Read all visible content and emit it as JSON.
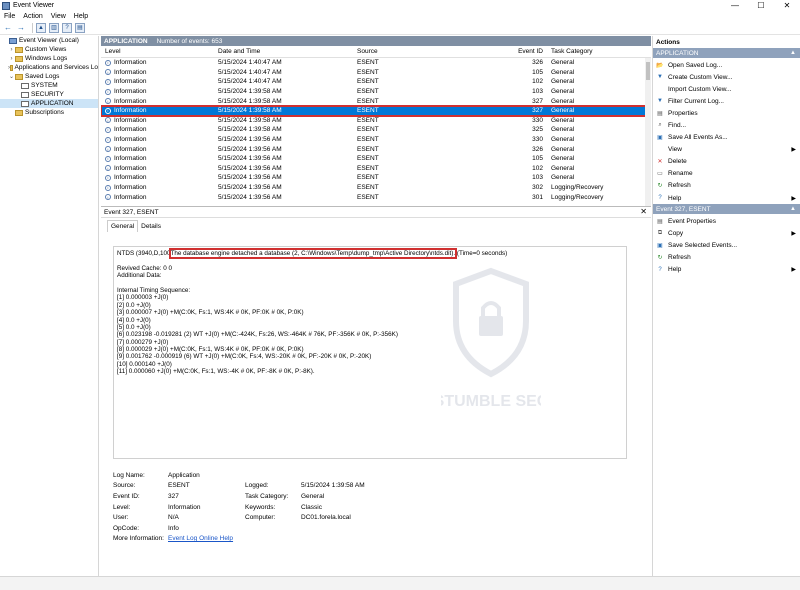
{
  "window": {
    "title": "Event Viewer",
    "min": "—",
    "max": "☐",
    "close": "✕"
  },
  "menu": [
    "File",
    "Action",
    "View",
    "Help"
  ],
  "tree": [
    {
      "label": "Event Viewer (Local)",
      "exp": "",
      "icon": "root",
      "indent": 0
    },
    {
      "label": "Custom Views",
      "exp": "›",
      "icon": "folder",
      "indent": 1
    },
    {
      "label": "Windows Logs",
      "exp": "›",
      "icon": "folder",
      "indent": 1
    },
    {
      "label": "Applications and Services Lo",
      "exp": "›",
      "icon": "folder",
      "indent": 1
    },
    {
      "label": "Saved Logs",
      "exp": "⌄",
      "icon": "folder",
      "indent": 1
    },
    {
      "label": "SYSTEM",
      "exp": "",
      "icon": "log",
      "indent": 2
    },
    {
      "label": "SECURITY",
      "exp": "",
      "icon": "log",
      "indent": 2
    },
    {
      "label": "APPLICATION",
      "exp": "",
      "icon": "log",
      "indent": 2,
      "selected": true
    },
    {
      "label": "Subscriptions",
      "exp": "",
      "icon": "folder",
      "indent": 1
    }
  ],
  "log": {
    "name": "APPLICATION",
    "count": "Number of events: 653"
  },
  "columns": {
    "level": "Level",
    "date": "Date and Time",
    "source": "Source",
    "id": "Event ID",
    "cat": "Task Category"
  },
  "rows": [
    {
      "level": "Information",
      "date": "5/15/2024 1:40:47 AM",
      "source": "ESENT",
      "id": "326",
      "cat": "General"
    },
    {
      "level": "Information",
      "date": "5/15/2024 1:40:47 AM",
      "source": "ESENT",
      "id": "105",
      "cat": "General"
    },
    {
      "level": "Information",
      "date": "5/15/2024 1:40:47 AM",
      "source": "ESENT",
      "id": "102",
      "cat": "General"
    },
    {
      "level": "Information",
      "date": "5/15/2024 1:39:58 AM",
      "source": "ESENT",
      "id": "103",
      "cat": "General"
    },
    {
      "level": "Information",
      "date": "5/15/2024 1:39:58 AM",
      "source": "ESENT",
      "id": "327",
      "cat": "General"
    },
    {
      "level": "Information",
      "date": "5/15/2024 1:39:58 AM",
      "source": "ESENT",
      "id": "327",
      "cat": "General",
      "selected": true
    },
    {
      "level": "Information",
      "date": "5/15/2024 1:39:58 AM",
      "source": "ESENT",
      "id": "330",
      "cat": "General"
    },
    {
      "level": "Information",
      "date": "5/15/2024 1:39:58 AM",
      "source": "ESENT",
      "id": "325",
      "cat": "General"
    },
    {
      "level": "Information",
      "date": "5/15/2024 1:39:56 AM",
      "source": "ESENT",
      "id": "330",
      "cat": "General"
    },
    {
      "level": "Information",
      "date": "5/15/2024 1:39:56 AM",
      "source": "ESENT",
      "id": "326",
      "cat": "General"
    },
    {
      "level": "Information",
      "date": "5/15/2024 1:39:56 AM",
      "source": "ESENT",
      "id": "105",
      "cat": "General"
    },
    {
      "level": "Information",
      "date": "5/15/2024 1:39:56 AM",
      "source": "ESENT",
      "id": "102",
      "cat": "General"
    },
    {
      "level": "Information",
      "date": "5/15/2024 1:39:56 AM",
      "source": "ESENT",
      "id": "103",
      "cat": "General"
    },
    {
      "level": "Information",
      "date": "5/15/2024 1:39:56 AM",
      "source": "ESENT",
      "id": "302",
      "cat": "Logging/Recovery"
    },
    {
      "level": "Information",
      "date": "5/15/2024 1:39:56 AM",
      "source": "ESENT",
      "id": "301",
      "cat": "Logging/Recovery"
    }
  ],
  "detail": {
    "title": "Event 327, ESENT",
    "close": "✕",
    "tabs": [
      "General",
      "Details"
    ],
    "msg_prefix": "NTDS (3940,D,100",
    "msg_highlight": "The database engine detached a database (2, C:\\Windows\\Temp\\dump_tmp\\Active Directory\\ntds.dit).",
    "msg_suffix": " (Time=0 seconds)",
    "lines": [
      "",
      "Revived Cache: 0 0",
      "Additional Data:",
      "",
      "Internal Timing Sequence:",
      "[1] 0.000003 +J(0)",
      "[2] 0.0 +J(0)",
      "[3] 0.000007 +J(0) +M(C:0K, Fs:1, WS:4K # 0K, PF:0K # 0K, P:0K)",
      "[4] 0.0 +J(0)",
      "[5] 0.0 +J(0)",
      "[6] 0.023198 -0.019281 (2) WT +J(0) +M(C:-424K, Fs:26, WS:-464K # 76K, PF:-356K # 0K, P:-356K)",
      "[7] 0.000279 +J(0)",
      "[8] 0.000029 +J(0) +M(C:0K, Fs:1, WS:4K # 0K, PF:0K # 0K, P:0K)",
      "[9] 0.001762 -0.000919 (6) WT +J(0) +M(C:0K, Fs:4, WS:-20K # 0K, PF:-20K # 0K, P:-20K)",
      "[10] 0.000140 +J(0)",
      "[11] 0.000060 +J(0) +M(C:0K, Fs:1, WS:-4K # 0K, PF:-8K # 0K, P:-8K)."
    ],
    "props": {
      "log_name_l": "Log Name:",
      "log_name_v": "Application",
      "source_l": "Source:",
      "source_v": "ESENT",
      "logged_l": "Logged:",
      "logged_v": "5/15/2024 1:39:58 AM",
      "event_id_l": "Event ID:",
      "event_id_v": "327",
      "task_l": "Task Category:",
      "task_v": "General",
      "level_l": "Level:",
      "level_v": "Information",
      "keywords_l": "Keywords:",
      "keywords_v": "Classic",
      "user_l": "User:",
      "user_v": "N/A",
      "computer_l": "Computer:",
      "computer_v": "DC01.forela.local",
      "opcode_l": "OpCode:",
      "opcode_v": "Info",
      "more_l": "More Information:",
      "more_v": "Event Log Online Help"
    }
  },
  "watermark": {
    "text": "STUMBLE SEC"
  },
  "actions": {
    "title": "Actions",
    "sections": [
      {
        "label": "APPLICATION",
        "items": [
          {
            "label": "Open Saved Log...",
            "icon": "open-icon",
            "glyph": "📂",
            "sub": false
          },
          {
            "label": "Create Custom View...",
            "icon": "filter-create-icon",
            "glyph": "▼",
            "sub": false
          },
          {
            "label": "Import Custom View...",
            "icon": "import-icon",
            "glyph": "",
            "sub": false
          },
          {
            "label": "Filter Current Log...",
            "icon": "filter-icon",
            "glyph": "▼",
            "sub": false
          },
          {
            "label": "Properties",
            "icon": "properties-icon",
            "glyph": "▤",
            "sub": false
          },
          {
            "label": "Find...",
            "icon": "find-icon",
            "glyph": "⌕",
            "sub": false
          },
          {
            "label": "Save All Events As...",
            "icon": "save-icon",
            "glyph": "▣",
            "sub": false
          },
          {
            "label": "View",
            "icon": "view-icon",
            "glyph": "",
            "sub": true
          },
          {
            "label": "Delete",
            "icon": "delete-icon",
            "glyph": "✕",
            "sub": false
          },
          {
            "label": "Rename",
            "icon": "rename-icon",
            "glyph": "▭",
            "sub": false
          },
          {
            "label": "Refresh",
            "icon": "refresh-icon",
            "glyph": "↻",
            "sub": false
          },
          {
            "label": "Help",
            "icon": "help-icon",
            "glyph": "?",
            "sub": true
          }
        ]
      },
      {
        "label": "Event 327, ESENT",
        "items": [
          {
            "label": "Event Properties",
            "icon": "event-properties-icon",
            "glyph": "▤",
            "sub": false
          },
          {
            "label": "Copy",
            "icon": "copy-icon",
            "glyph": "⧉",
            "sub": true
          },
          {
            "label": "Save Selected Events...",
            "icon": "save-selected-icon",
            "glyph": "▣",
            "sub": false
          },
          {
            "label": "Refresh",
            "icon": "refresh-icon",
            "glyph": "↻",
            "sub": false
          },
          {
            "label": "Help",
            "icon": "help-icon",
            "glyph": "?",
            "sub": true
          }
        ]
      }
    ]
  },
  "colors": {
    "header": "#7f8fa3",
    "selection": "#0078d7",
    "highlight": "#d03030",
    "section": "#8fa2bc"
  }
}
